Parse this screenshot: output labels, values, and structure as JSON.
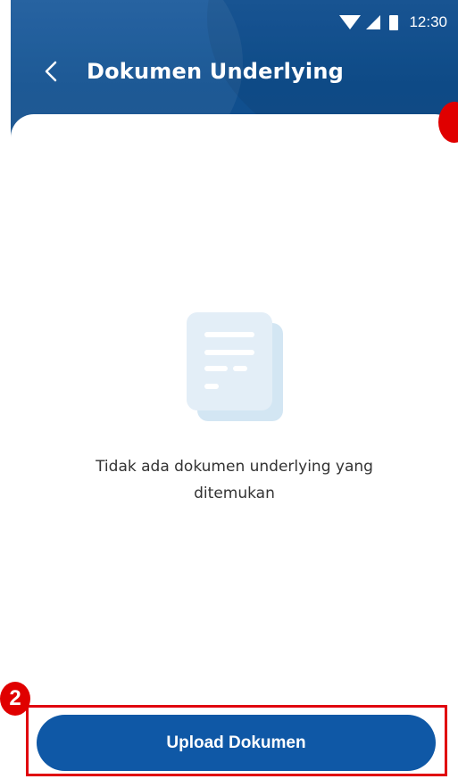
{
  "status_bar": {
    "time": "12:30",
    "icons": [
      "wifi-icon",
      "signal-icon",
      "battery-icon"
    ]
  },
  "header": {
    "title": "Dokumen Underlying",
    "back_icon": "chevron-left-icon"
  },
  "empty_state": {
    "illustration": "document-icon",
    "message_line1": "Tidak ada dokumen underlying yang",
    "message_line2": "ditemukan"
  },
  "actions": {
    "upload_label": "Upload Dokumen"
  },
  "annotations": {
    "marker_2_label": "2"
  },
  "colors": {
    "header_bg": "#134f8c",
    "primary_button": "#0f58a6",
    "annotation_red": "#e00000",
    "illustration_fill": "#e3eef7"
  }
}
